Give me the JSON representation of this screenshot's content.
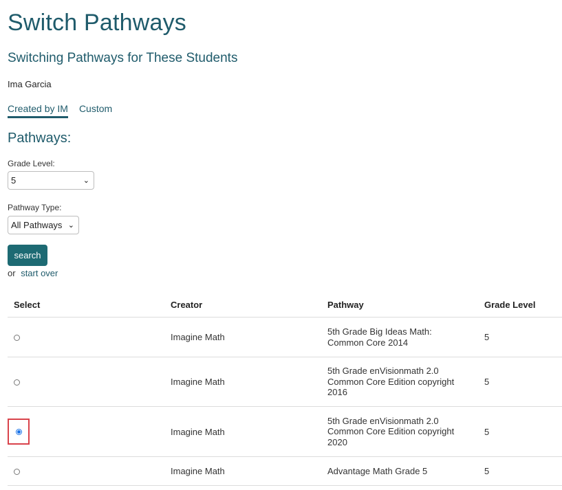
{
  "page": {
    "title": "Switch Pathways",
    "subtitle": "Switching Pathways for These Students",
    "student": "Ima Garcia"
  },
  "tabs": [
    {
      "label": "Created by IM",
      "active": true
    },
    {
      "label": "Custom",
      "active": false
    }
  ],
  "filters": {
    "heading": "Pathways:",
    "grade_label": "Grade Level:",
    "grade_value": "5",
    "type_label": "Pathway Type:",
    "type_value": "All Pathways"
  },
  "actions": {
    "search_label": "search",
    "or_text": "or",
    "start_over_label": "start over"
  },
  "table": {
    "headers": [
      "Select",
      "Creator",
      "Pathway",
      "Grade Level"
    ],
    "rows": [
      {
        "selected": false,
        "creator": "Imagine Math",
        "pathway": "5th Grade Big Ideas Math: Common Core 2014",
        "grade": "5"
      },
      {
        "selected": false,
        "creator": "Imagine Math",
        "pathway": "5th Grade enVisionmath 2.0 Common Core Edition copyright 2016",
        "grade": "5"
      },
      {
        "selected": true,
        "creator": "Imagine Math",
        "pathway": "5th Grade enVisionmath 2.0 Common Core Edition copyright 2020",
        "grade": "5"
      },
      {
        "selected": false,
        "creator": "Imagine Math",
        "pathway": "Advantage Math Grade 5",
        "grade": "5"
      }
    ]
  },
  "colors": {
    "heading": "#1f5b6b",
    "button": "#1d6a73",
    "highlight": "#d9424a",
    "radio_selected": "#1a73e8"
  }
}
